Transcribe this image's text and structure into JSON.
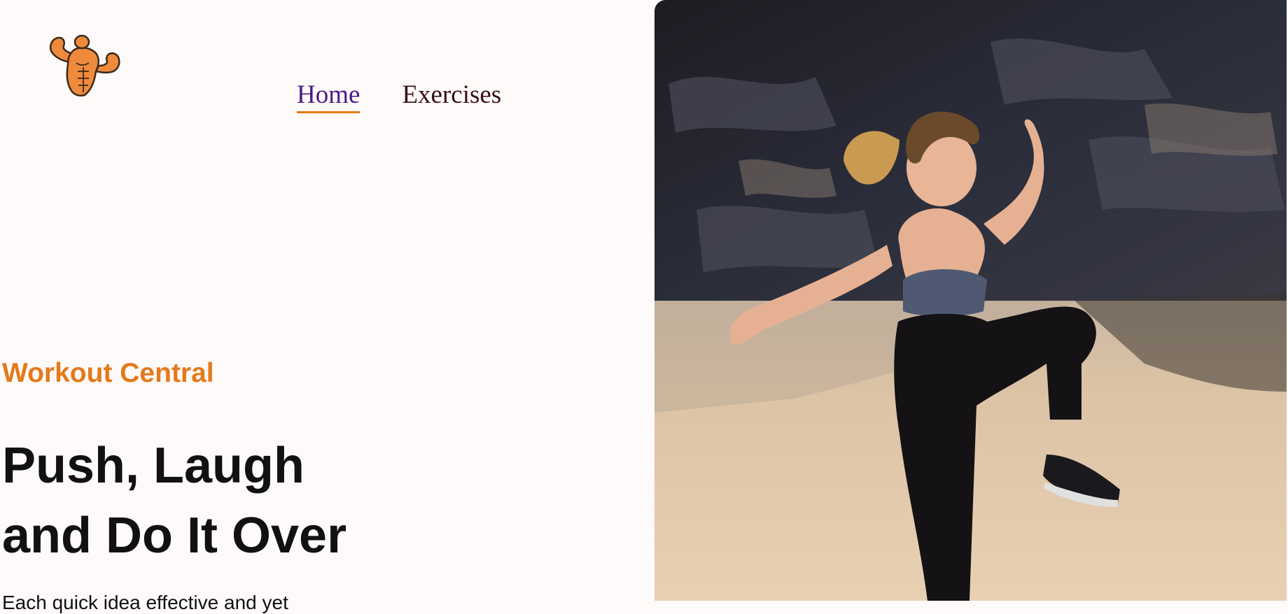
{
  "header": {
    "logo_icon": "flexing-bodybuilder-icon",
    "nav": [
      {
        "label": "Home",
        "active": true
      },
      {
        "label": "Exercises",
        "active": false
      }
    ]
  },
  "hero": {
    "brand": "Workout Central",
    "headline_line1": "Push, Laugh",
    "headline_line2": "and Do It Over",
    "subtext": "Each quick idea effective and yet"
  },
  "colors": {
    "accent": "#e47a1a",
    "nav_active": "#4b1a86",
    "background": "#fffafa"
  }
}
